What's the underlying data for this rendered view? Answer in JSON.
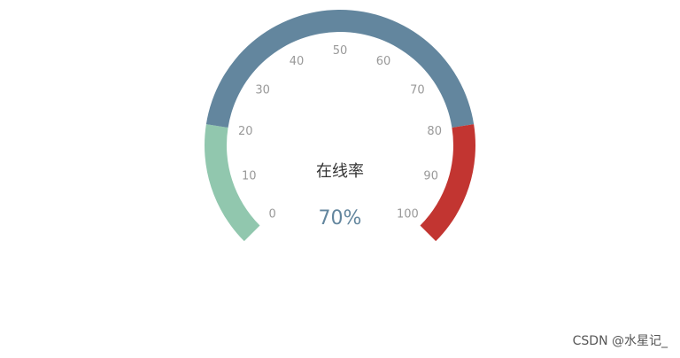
{
  "chart_data": {
    "type": "gauge",
    "title": "在线率",
    "value": 70,
    "value_label": "70%",
    "min": 0,
    "max": 100,
    "tick_labels": [
      "0",
      "10",
      "20",
      "30",
      "40",
      "50",
      "60",
      "70",
      "80",
      "90",
      "100"
    ],
    "bands": [
      {
        "from": 0,
        "to": 20,
        "color": "#91c7ae"
      },
      {
        "from": 20,
        "to": 80,
        "color": "#63869e"
      },
      {
        "from": 80,
        "to": 100,
        "color": "#c23531"
      }
    ],
    "value_color": "#63869e"
  },
  "watermark": "CSDN @水星记_"
}
